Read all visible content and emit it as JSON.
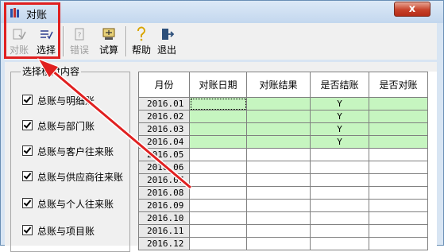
{
  "window": {
    "title": "对账",
    "close_label": "x"
  },
  "toolbar": {
    "buttons": [
      {
        "label": "对账",
        "enabled": false,
        "icon": "reconcile-icon"
      },
      {
        "label": "选择",
        "enabled": true,
        "icon": "select-icon"
      },
      {
        "label": "错误",
        "enabled": false,
        "icon": "error-icon"
      },
      {
        "label": "试算",
        "enabled": true,
        "icon": "scale-icon"
      },
      {
        "label": "帮助",
        "enabled": true,
        "icon": "help-icon"
      },
      {
        "label": "退出",
        "enabled": true,
        "icon": "exit-icon"
      }
    ]
  },
  "group": {
    "title": "选择核对内容",
    "items": [
      {
        "label": "总账与明细账",
        "checked": true
      },
      {
        "label": "总账与部门账",
        "checked": true
      },
      {
        "label": "总账与客户往来账",
        "checked": true
      },
      {
        "label": "总账与供应商往来账",
        "checked": true
      },
      {
        "label": "总账与个人往来账",
        "checked": true
      },
      {
        "label": "总账与项目账",
        "checked": true
      }
    ]
  },
  "table": {
    "headers": [
      "月份",
      "对账日期",
      "对账结果",
      "是否结账",
      "是否对账"
    ],
    "rows": [
      {
        "month": "2016.01",
        "date": "",
        "result": "",
        "closed": "Y",
        "reconciled": "",
        "green": true
      },
      {
        "month": "2016.02",
        "date": "",
        "result": "",
        "closed": "Y",
        "reconciled": "",
        "green": true
      },
      {
        "month": "2016.03",
        "date": "",
        "result": "",
        "closed": "Y",
        "reconciled": "",
        "green": true
      },
      {
        "month": "2016.04",
        "date": "",
        "result": "",
        "closed": "Y",
        "reconciled": "",
        "green": true
      },
      {
        "month": "2016.05",
        "date": "",
        "result": "",
        "closed": "",
        "reconciled": "",
        "green": false
      },
      {
        "month": "2016.06",
        "date": "",
        "result": "",
        "closed": "",
        "reconciled": "",
        "green": false
      },
      {
        "month": "2016.07",
        "date": "",
        "result": "",
        "closed": "",
        "reconciled": "",
        "green": false
      },
      {
        "month": "2016.08",
        "date": "",
        "result": "",
        "closed": "",
        "reconciled": "",
        "green": false
      },
      {
        "month": "2016.09",
        "date": "",
        "result": "",
        "closed": "",
        "reconciled": "",
        "green": false
      },
      {
        "month": "2016.10",
        "date": "",
        "result": "",
        "closed": "",
        "reconciled": "",
        "green": false
      },
      {
        "month": "2016.11",
        "date": "",
        "result": "",
        "closed": "",
        "reconciled": "",
        "green": false
      },
      {
        "month": "2016.12",
        "date": "",
        "result": "",
        "closed": "",
        "reconciled": "",
        "green": false
      }
    ]
  },
  "colors": {
    "accent_red": "#e02020",
    "closed_green": "#c6f5c0",
    "title_bar": "#c3d7ee"
  }
}
